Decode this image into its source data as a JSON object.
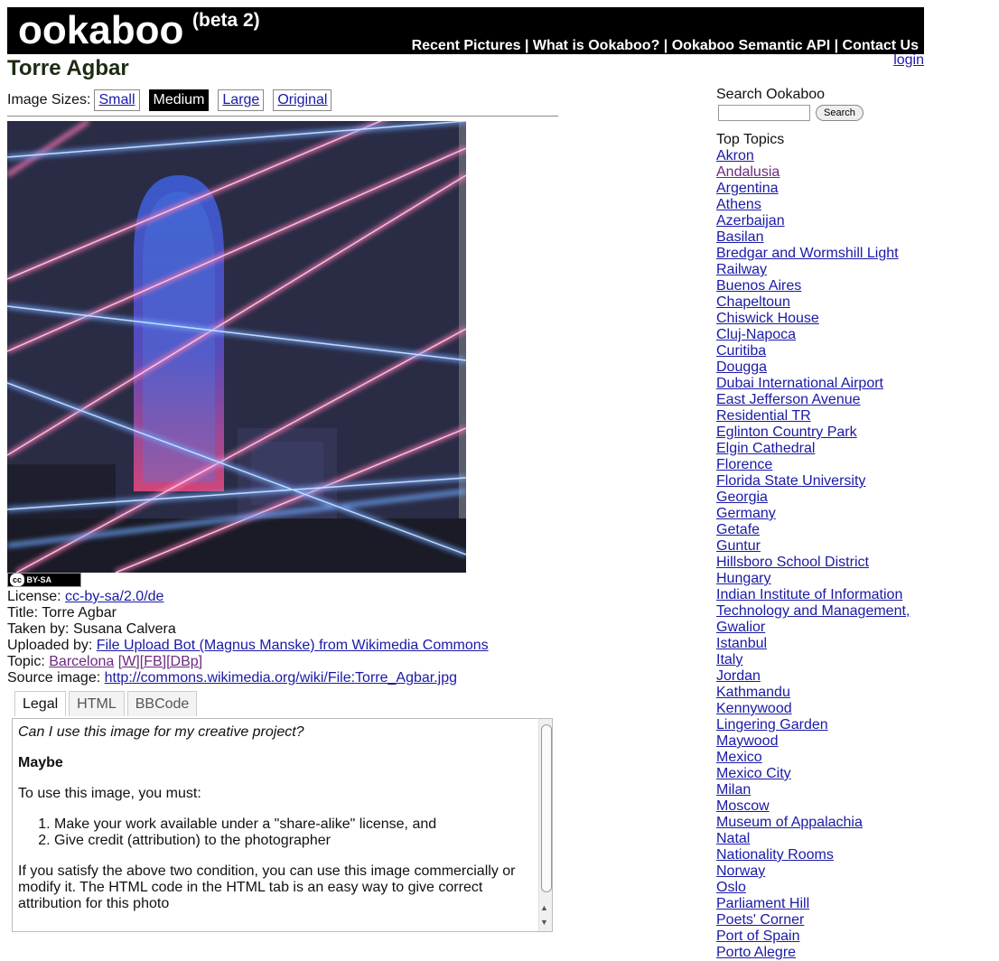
{
  "header": {
    "logo": "ookaboo",
    "logo_sup": "(beta 2)",
    "nav": [
      {
        "label": "Recent Pictures"
      },
      {
        "label": "What is Ookaboo?"
      },
      {
        "label": "Ookaboo Semantic API"
      },
      {
        "label": "Contact Us"
      }
    ],
    "separator": " | ",
    "login": "login"
  },
  "page_title": "Torre Agbar",
  "image_sizes": {
    "label": "Image Sizes:",
    "options": [
      "Small",
      "Medium",
      "Large",
      "Original"
    ],
    "selected": "Medium"
  },
  "badge": {
    "cc": "cc",
    "text": "BY-SA"
  },
  "meta": {
    "license_label": "License:",
    "license_value": "cc-by-sa/2.0/de",
    "title_label": "Title:",
    "title_value": "Torre Agbar",
    "taken_label": "Taken by:",
    "taken_value": "Susana Calvera",
    "uploaded_label": "Uploaded by:",
    "uploaded_value": "File Upload Bot (Magnus Manske) from Wikimedia Commons",
    "topic_label": "Topic:",
    "topic_value": "Barcelona",
    "topic_links": [
      "[W]",
      "[FB]",
      "[DBp]"
    ],
    "source_label": "Source image:",
    "source_value": "http://commons.wikimedia.org/wiki/File:Torre_Agbar.jpg"
  },
  "tabs": {
    "items": [
      "Legal",
      "HTML",
      "BBCode"
    ],
    "active": "Legal"
  },
  "legal": {
    "question": "Can I use this image for my creative project?",
    "answer": "Maybe",
    "intro": "To use this image, you must:",
    "steps": [
      "Make your work available under a \"share-alike\" license, and",
      "Give credit (attribution) to the photographer"
    ],
    "closing": "If you satisfy the above two condition, you can use this image commercially or modify it. The HTML code in the HTML tab is an easy way to give correct attribution for this photo"
  },
  "sidebar": {
    "search_label": "Search Ookaboo",
    "search_value": "",
    "search_button": "Search",
    "topics_label": "Top Topics",
    "topics": [
      "Akron",
      "Andalusia",
      "Argentina",
      "Athens",
      "Azerbaijan",
      "Basilan",
      "Bredgar and Wormshill Light",
      "Railway",
      "Buenos Aires",
      "Chapeltoun",
      "Chiswick House",
      "Cluj-Napoca",
      "Curitiba",
      "Dougga",
      "Dubai International Airport",
      "East Jefferson Avenue",
      "Residential TR",
      "Eglinton Country Park",
      "Elgin Cathedral",
      "Florence",
      "Florida State University",
      "Georgia",
      "Germany",
      "Getafe",
      "Guntur",
      "Hillsboro School District",
      "Hungary",
      "Indian Institute of Information",
      "Technology and Management,",
      "Gwalior",
      "Istanbul",
      "Italy",
      "Jordan",
      "Kathmandu",
      "Kennywood",
      "Lingering Garden",
      "Maywood",
      "Mexico",
      "Mexico City",
      "Milan",
      "Moscow",
      "Museum of Appalachia",
      "Natal",
      "Nationality Rooms",
      "Norway",
      "Oslo",
      "Parliament Hill",
      "Poets' Corner",
      "Port of Spain",
      "Porto Alegre"
    ],
    "visited_topic": "Andalusia"
  },
  "colors": {
    "link": "#1a1aa6",
    "visited": "#6b2a7f",
    "header_bg": "#000000",
    "laser_blue": "#6fa8ff",
    "laser_pink": "#ff7ab8"
  }
}
